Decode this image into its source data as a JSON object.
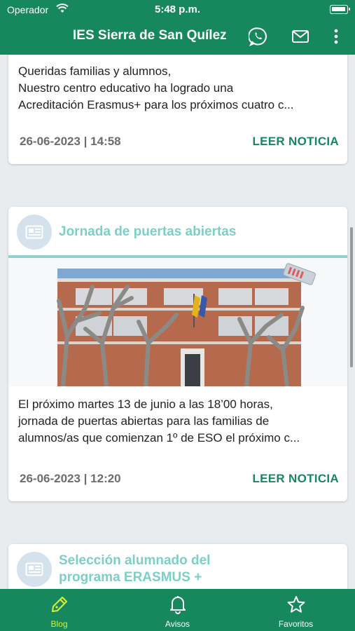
{
  "status": {
    "carrier": "Operador",
    "time": "5:48 p.m."
  },
  "appbar": {
    "title": "IES Sierra de San Quílez"
  },
  "posts": [
    {
      "body": "Queridas familias y alumnos,\nNuestro centro educativo ha logrado una\nAcreditación Erasmus+ para los próximos cuatro c...",
      "date": "26-06-2023 | 14:58",
      "action": "LEER NOTICIA"
    },
    {
      "title": "Jornada de puertas abiertas",
      "body": "El próximo martes 13 de junio a las 18’00 horas,\njornada de puertas abiertas para las familias de\nalumnos/as que comienzan 1º de ESO el próximo c...",
      "date": "26-06-2023 | 12:20",
      "action": "LEER NOTICIA"
    },
    {
      "title": "Selección alumnado del\nprograma ERASMUS +"
    }
  ],
  "tabs": [
    {
      "label": "Blog",
      "icon": "pen-icon",
      "active": true
    },
    {
      "label": "Avisos",
      "icon": "bell-icon",
      "active": false
    },
    {
      "label": "Favoritos",
      "icon": "star-icon",
      "active": false
    }
  ],
  "colors": {
    "primary": "#17875e",
    "accent_title": "#7ccfc6",
    "active_tab": "#d9f231"
  }
}
